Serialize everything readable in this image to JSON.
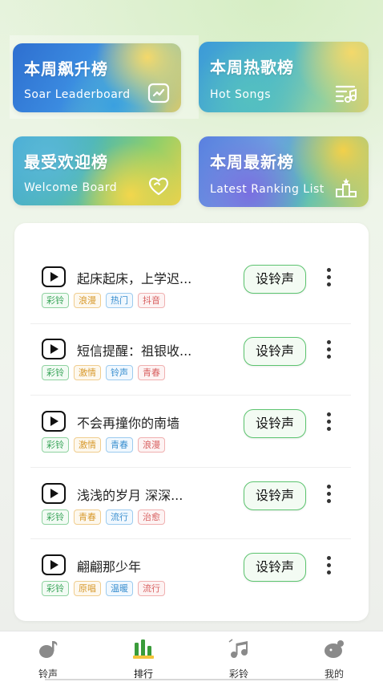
{
  "cards": [
    {
      "id": "soar",
      "title": "本周飙升榜",
      "subtitle": "Soar Leaderboard",
      "icon": "trending-chart-icon"
    },
    {
      "id": "hot",
      "title": "本周热歌榜",
      "subtitle": "Hot Songs",
      "icon": "music-playlist-icon"
    },
    {
      "id": "welcome",
      "title": "最受欢迎榜",
      "subtitle": "Welcome Board",
      "icon": "heart-icon"
    },
    {
      "id": "latest",
      "title": "本周最新榜",
      "subtitle": "Latest Ranking List",
      "icon": "podium-icon"
    }
  ],
  "songs": [
    {
      "title": "起床起床，上学迟...",
      "button": "设铃声",
      "tags": [
        {
          "t": "彩铃",
          "c": "green"
        },
        {
          "t": "浪漫",
          "c": "orange"
        },
        {
          "t": "热门",
          "c": "blue"
        },
        {
          "t": "抖音",
          "c": "red"
        }
      ]
    },
    {
      "title": "短信提醒：祖银收...",
      "button": "设铃声",
      "tags": [
        {
          "t": "彩铃",
          "c": "green"
        },
        {
          "t": "激情",
          "c": "orange"
        },
        {
          "t": "铃声",
          "c": "blue"
        },
        {
          "t": "青春",
          "c": "red"
        }
      ]
    },
    {
      "title": "不会再撞你的南墙",
      "button": "设铃声",
      "tags": [
        {
          "t": "彩铃",
          "c": "green"
        },
        {
          "t": "激情",
          "c": "orange"
        },
        {
          "t": "青春",
          "c": "blue"
        },
        {
          "t": "浪漫",
          "c": "red"
        }
      ]
    },
    {
      "title": "浅浅的岁月 深深...",
      "button": "设铃声",
      "tags": [
        {
          "t": "彩铃",
          "c": "green"
        },
        {
          "t": "青春",
          "c": "orange"
        },
        {
          "t": "流行",
          "c": "blue"
        },
        {
          "t": "治愈",
          "c": "red"
        }
      ]
    },
    {
      "title": "翩翩那少年",
      "button": "设铃声",
      "tags": [
        {
          "t": "彩铃",
          "c": "green"
        },
        {
          "t": "原唱",
          "c": "orange"
        },
        {
          "t": "温暖",
          "c": "blue"
        },
        {
          "t": "流行",
          "c": "red"
        }
      ]
    }
  ],
  "tabs": [
    {
      "label": "铃声",
      "icon": "music-note-icon",
      "active": false
    },
    {
      "label": "排行",
      "icon": "ranking-bars-icon",
      "active": true
    },
    {
      "label": "彩铃",
      "icon": "double-note-icon",
      "active": false
    },
    {
      "label": "我的",
      "icon": "profile-icon",
      "active": false
    }
  ],
  "colors": {
    "accent_green": "#5cc46f",
    "tab_active": "#3a9c3a"
  }
}
